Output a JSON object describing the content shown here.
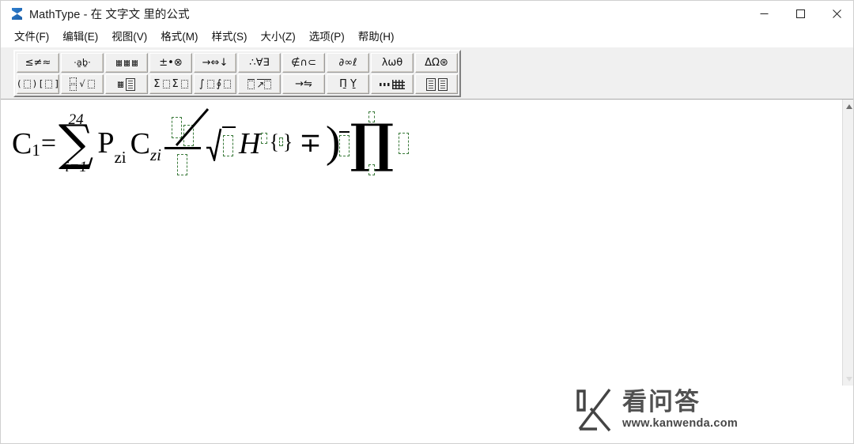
{
  "window": {
    "title": "MathType - 在 文字文 里的公式",
    "app_icon": "sigma-icon",
    "controls": [
      {
        "name": "minimize",
        "glyph": "—"
      },
      {
        "name": "maximize",
        "glyph": "□"
      },
      {
        "name": "close",
        "glyph": "✕"
      }
    ]
  },
  "menubar": {
    "items": [
      {
        "label": "文件(F)",
        "name": "menu-file"
      },
      {
        "label": "编辑(E)",
        "name": "menu-edit"
      },
      {
        "label": "视图(V)",
        "name": "menu-view"
      },
      {
        "label": "格式(M)",
        "name": "menu-format"
      },
      {
        "label": "样式(S)",
        "name": "menu-style"
      },
      {
        "label": "大小(Z)",
        "name": "menu-size"
      },
      {
        "label": "选项(P)",
        "name": "menu-options"
      },
      {
        "label": "帮助(H)",
        "name": "menu-help"
      }
    ]
  },
  "toolbar": {
    "row1": [
      {
        "name": "relations-palette",
        "glyph": "≤ ≠ ≈"
      },
      {
        "name": "spaces-dots-palette",
        "glyph": "∴ ab ˙"
      },
      {
        "name": "embellishments-palette",
        "glyph": "ẋ ä ä"
      },
      {
        "name": "operators-palette",
        "glyph": "± • ⊗"
      },
      {
        "name": "arrows-palette",
        "glyph": "→ ⇔ ↓"
      },
      {
        "name": "logic-palette",
        "glyph": "∴ ∀ ∃"
      },
      {
        "name": "sets-palette",
        "glyph": "∉ ∩ ⊂"
      },
      {
        "name": "misc-symbols-palette",
        "glyph": "∂ ∞ ℓ"
      },
      {
        "name": "greek-lower-palette",
        "glyph": "λ ω θ"
      },
      {
        "name": "greek-upper-palette",
        "glyph": "Δ Ω ⊛"
      }
    ],
    "row2": [
      {
        "name": "fences-palette",
        "glyph": "(∷) [∷]"
      },
      {
        "name": "fraction-radical-palette",
        "glyph": "∷ √"
      },
      {
        "name": "subscript-superscript-palette",
        "glyph": "∷ ∷"
      },
      {
        "name": "summation-palette",
        "glyph": "Σ Σ"
      },
      {
        "name": "integral-palette",
        "glyph": "∫ ∮"
      },
      {
        "name": "underbar-overbar-palette",
        "glyph": "‾ →"
      },
      {
        "name": "labeled-arrow-palette",
        "glyph": "→ ⇌"
      },
      {
        "name": "product-set-palette",
        "glyph": "Π ∪"
      },
      {
        "name": "matrix-template-palette",
        "glyph": "□□□ ∷"
      },
      {
        "name": "matrix-palette",
        "glyph": "▦ ▦"
      }
    ]
  },
  "document": {
    "equation_description": "C_1 = sum from i=1 to 24 of P_zi C_zi times fraction with slash over empty slot, radical of empty slot, H with superscript slot and braces, minus-plus, big paren with overbar slot, product with empty limits and slot",
    "equation": {
      "lhs_var": "C",
      "lhs_sub": "1",
      "equals": "=",
      "sum_symbol": "∑",
      "sum_upper": "24",
      "sum_lower": "i=1",
      "term1_var": "P",
      "term1_sub": "zi",
      "term2_var": "C",
      "term2_sub": "zi",
      "radical_symbol": "√",
      "h_var": "H",
      "brace_open": "{",
      "brace_close": "}",
      "minus_plus": "∓",
      "paren_open": ")",
      "product_symbol": "∏"
    }
  },
  "scrollbar": {
    "up_arrow": "▲",
    "down_arrow": "▼",
    "name": "vertical-scrollbar"
  },
  "watermark": {
    "brand_cn": "看问答",
    "url": "www.kanwenda.com"
  }
}
